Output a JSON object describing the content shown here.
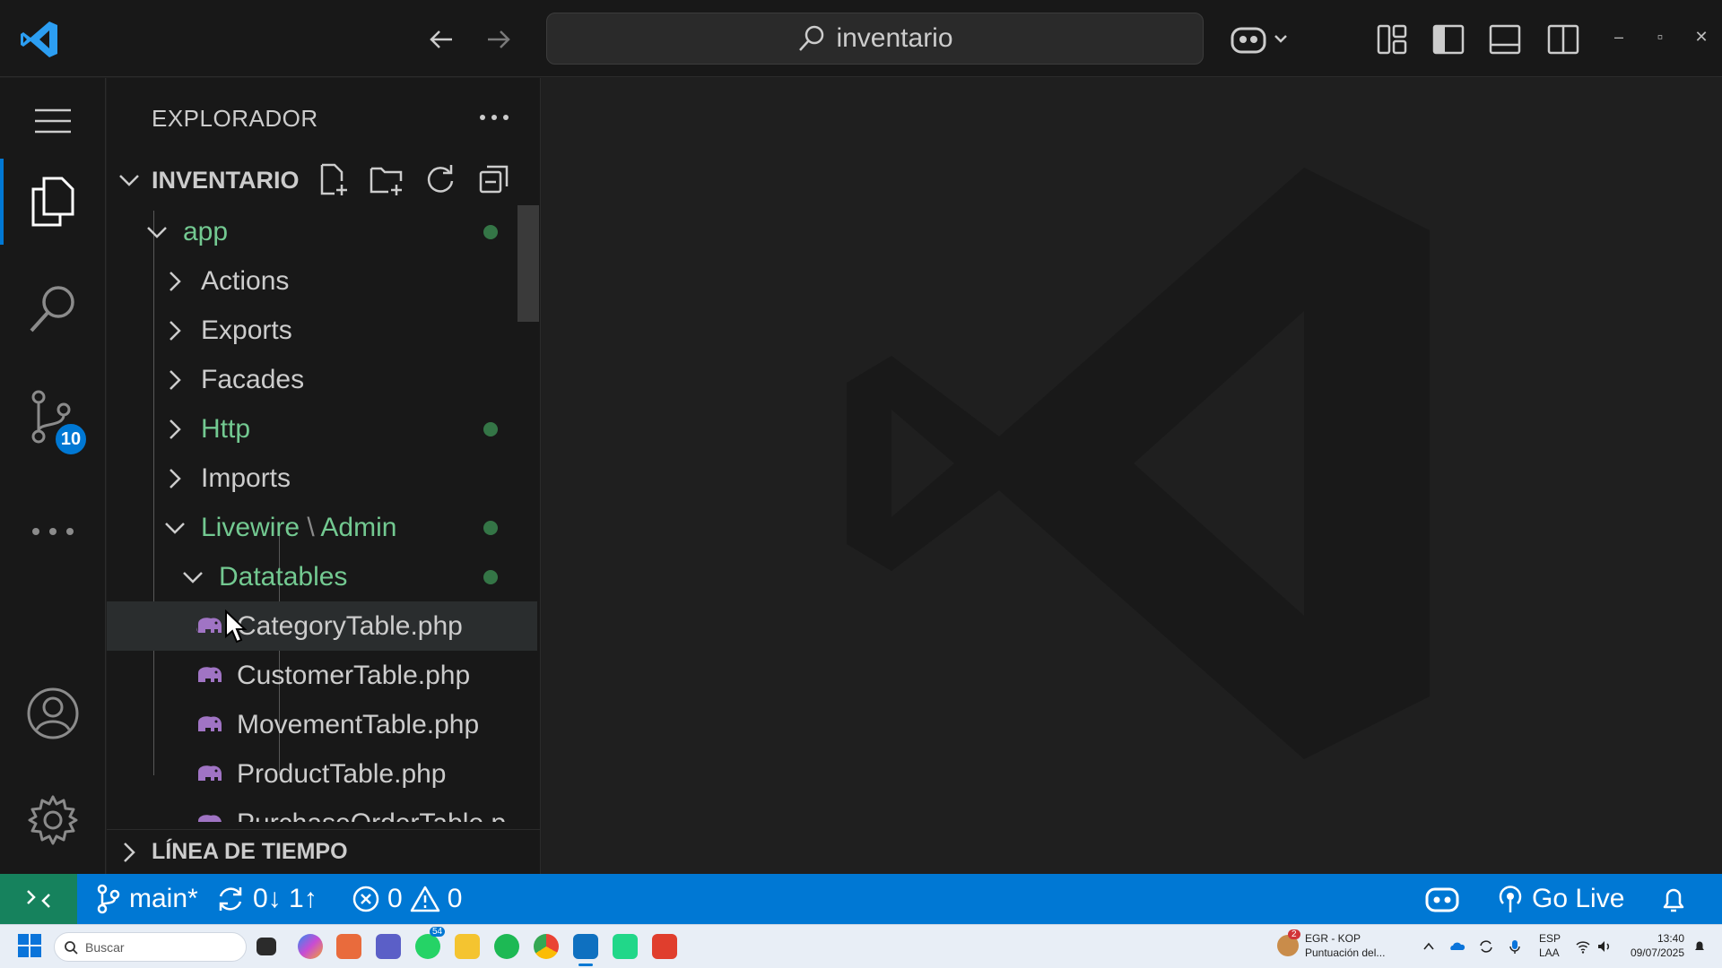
{
  "titlebar": {
    "search_text": "inventario"
  },
  "activity": {
    "scm_badge": "10"
  },
  "sidebar": {
    "title": "EXPLORADOR",
    "workspace": "INVENTARIO",
    "timeline": "LÍNEA DE TIEMPO",
    "tree": {
      "app": "app",
      "actions": "Actions",
      "exports": "Exports",
      "facades": "Facades",
      "http": "Http",
      "imports": "Imports",
      "livewire": "Livewire",
      "livewire_sep": "\\",
      "admin": "Admin",
      "datatables": "Datatables",
      "files": [
        "CategoryTable.php",
        "CustomerTable.php",
        "MovementTable.php",
        "ProductTable.php",
        "PurchaseOrderTable.p"
      ]
    }
  },
  "statusbar": {
    "branch": "main*",
    "sync": "0↓ 1↑",
    "errors": "0",
    "warnings": "0",
    "go_live": "Go Live"
  },
  "taskbar": {
    "search_placeholder": "Buscar",
    "notification_title": "EGR - KOP",
    "notification_sub": "Puntuación del...",
    "notification_count": "2",
    "lang_top": "ESP",
    "lang_bottom": "LAA",
    "time": "13:40",
    "date": "09/07/2025",
    "whatsapp_badge": "54"
  },
  "colors": {
    "accent": "#0078d4",
    "git_modified": "#73c991",
    "remote": "#16825d",
    "php_icon": "#a074c4"
  }
}
